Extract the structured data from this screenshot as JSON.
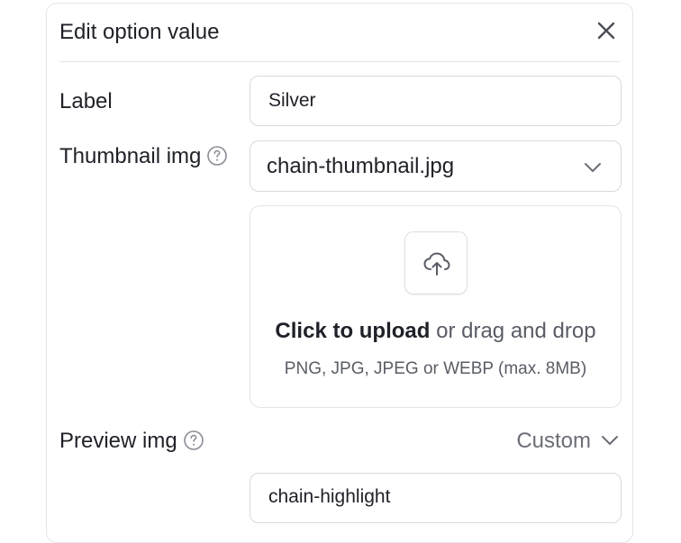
{
  "dialog": {
    "title": "Edit option value",
    "close_icon": "close-icon"
  },
  "label_field": {
    "label": "Label",
    "value": "Silver"
  },
  "thumbnail_field": {
    "label": "Thumbnail img",
    "help_icon": "question-circle-icon",
    "selected_file": "chain-thumbnail.jpg",
    "chevron_icon": "chevron-down-icon"
  },
  "upload": {
    "icon": "cloud-upload-icon",
    "click_text": "Click to upload",
    "drag_text": " or drag and drop",
    "hint": "PNG, JPG, JPEG or WEBP (max. 8MB)"
  },
  "preview_field": {
    "label": "Preview img",
    "help_icon": "question-circle-icon",
    "mode": "Custom",
    "chevron_icon": "chevron-down-icon",
    "next_input_partial": "chain-highlight"
  }
}
